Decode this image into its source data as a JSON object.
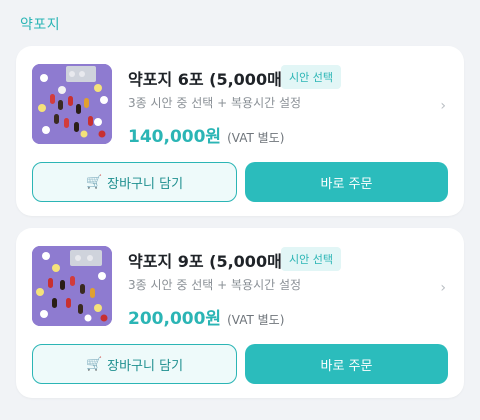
{
  "section": {
    "title": "약포지"
  },
  "products": [
    {
      "title": "약포지 6포 (5,000매)",
      "badge": "시안 선택",
      "description": "3종 시안 중 선택 + 복용시간 설정",
      "price": "140,000원",
      "vat": "(VAT 별도)",
      "cart_label": "장바구니 담기",
      "order_label": "바로 주문"
    },
    {
      "title": "약포지 9포 (5,000매)",
      "badge": "시안 선택",
      "description": "3종 시안 중 선택 + 복용시간 설정",
      "price": "200,000원",
      "vat": "(VAT 별도)",
      "cart_label": "장바구니 담기",
      "order_label": "바로 주문"
    }
  ],
  "icons": {
    "cart": "shopping-cart-icon",
    "chevron": "chevron-right-icon"
  },
  "colors": {
    "accent": "#2bbcbc",
    "accent_text": "#2bb5b5",
    "background": "#f1f3f6"
  }
}
